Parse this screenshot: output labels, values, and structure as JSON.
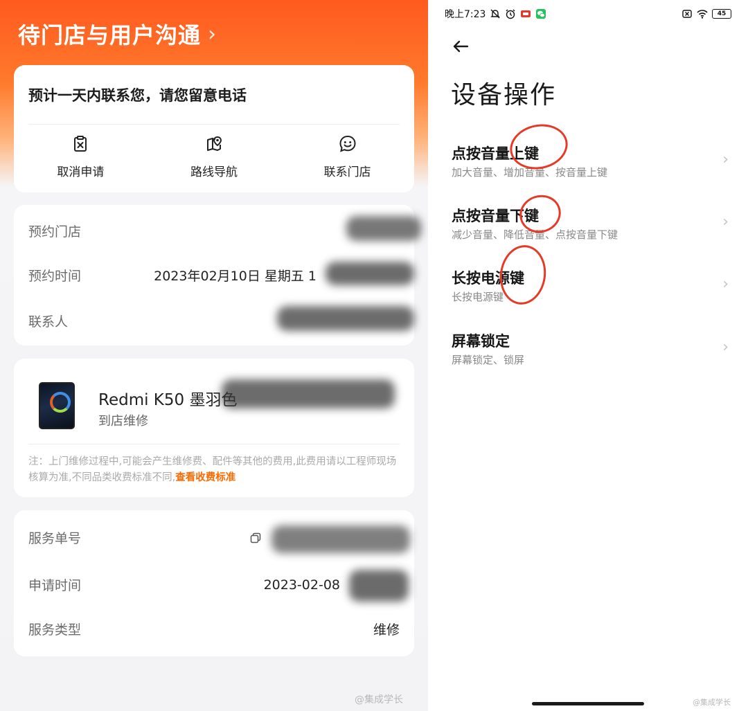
{
  "left": {
    "header": {
      "title": "待门店与用户沟通",
      "chevron": "›"
    },
    "contact_card": {
      "notice": "预计一天内联系您，请您留意电话",
      "actions": [
        {
          "label": "取消申请",
          "icon": "cancel-clipboard-icon"
        },
        {
          "label": "路线导航",
          "icon": "map-route-icon"
        },
        {
          "label": "联系门店",
          "icon": "chat-smile-icon"
        }
      ]
    },
    "appointment": {
      "store_label": "预约门店",
      "time_label": "预约时间",
      "time_value": "2023年02月10日 星期五 1",
      "contact_label": "联系人"
    },
    "product": {
      "name": "Redmi K50 墨羽色",
      "service": "到店维修",
      "note": "注：上门维修过程中,可能会产生维修费、配件等其他的费用,此费用请以工程师现场核算为准,不同品类收费标准不同,",
      "note_link": "查看收费标准"
    },
    "service_info": {
      "order_label": "服务单号",
      "apply_label": "申请时间",
      "apply_value": "2023-02-08",
      "type_label": "服务类型",
      "type_value": "维修"
    },
    "watermark": "@集成学长"
  },
  "right": {
    "status_bar": {
      "time": "晚上7:23",
      "battery": "45",
      "left_icons": [
        "mute-bell-icon",
        "alarm-icon",
        "app-notification-icon",
        "wechat-icon"
      ],
      "right_icons": [
        "no-sim-icon",
        "wifi-icon",
        "battery-icon"
      ]
    },
    "title": "设备操作",
    "items": [
      {
        "title": "点按音量上键",
        "subtitle": "加大音量、增加音量、按音量上键"
      },
      {
        "title": "点按音量下键",
        "subtitle": "减少音量、降低音量、点按音量下键"
      },
      {
        "title": "长按电源键",
        "subtitle": "长按电源键"
      },
      {
        "title": "屏幕锁定",
        "subtitle": "屏幕锁定、锁屏"
      }
    ],
    "watermark": "@集成学长",
    "annotation_color": "#e63a26"
  },
  "colors": {
    "brand_orange": "#ff5a1f",
    "link_orange": "#ff6a00"
  }
}
